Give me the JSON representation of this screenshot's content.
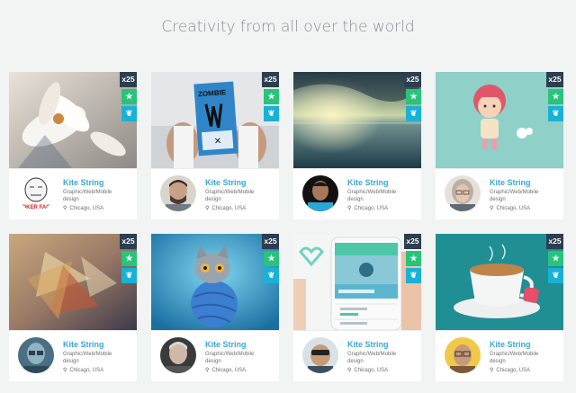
{
  "page": {
    "title": "Creativity from all over the world"
  },
  "cards": [
    {
      "count": "x25",
      "name": "Kite String",
      "role": "Graphic/Web/Mobile design",
      "location": "Chicago, USA",
      "art": "flowers",
      "avatar": "meme",
      "avatar_text": "POKER FACE"
    },
    {
      "count": "x25",
      "name": "Kite String",
      "role": "Graphic/Web/Mobile design",
      "location": "Chicago, USA",
      "art": "zombie-poster",
      "avatar": "man1"
    },
    {
      "count": "x25",
      "name": "Kite String",
      "role": "Graphic/Web/Mobile design",
      "location": "Chicago, USA",
      "art": "sea",
      "avatar": "man2"
    },
    {
      "count": "x25",
      "name": "Kite String",
      "role": "Graphic/Web/Mobile design",
      "location": "Chicago, USA",
      "art": "girl",
      "avatar": "woman1"
    },
    {
      "count": "x25",
      "name": "Kite String",
      "role": "Graphic/Web/Mobile design",
      "location": "Chicago, USA",
      "art": "triangles",
      "avatar": "man3"
    },
    {
      "count": "x25",
      "name": "Kite String",
      "role": "Graphic/Web/Mobile design",
      "location": "Chicago, USA",
      "art": "robot-cat",
      "avatar": "man4"
    },
    {
      "count": "x25",
      "name": "Kite String",
      "role": "Graphic/Web/Mobile design",
      "location": "Chicago, USA",
      "art": "mobile-app",
      "avatar": "man5"
    },
    {
      "count": "x25",
      "name": "Kite String",
      "role": "Graphic/Web/Mobile design",
      "location": "Chicago, USA",
      "art": "teacup",
      "avatar": "man6"
    }
  ],
  "icons": {
    "star": "star-icon",
    "paw": "paw-icon",
    "pin": "location-pin-icon"
  },
  "colors": {
    "name": "#3aa7d9",
    "count_badge": "#2c3e50",
    "star_badge": "#27c47a",
    "paw_badge": "#1ab1d6"
  }
}
